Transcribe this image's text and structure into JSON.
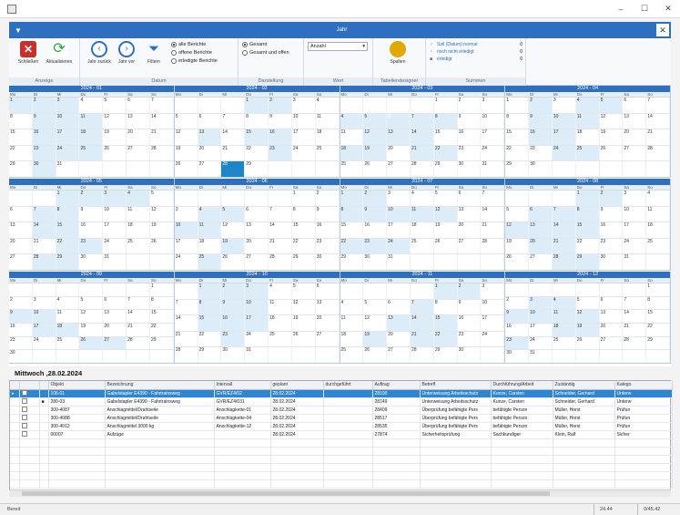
{
  "window": {
    "title": "",
    "minimize": "–",
    "maximize": "☐",
    "close": "✕"
  },
  "band": {
    "title": "Jahr",
    "arrow": "▼",
    "close": "✕"
  },
  "ribbon": {
    "groups": {
      "anzeige": "Anzeige",
      "datum": "Datum",
      "darstellung": "Darstellung",
      "wert": "Wert",
      "tabelle": "Tabellendesigner",
      "summen": "Summen"
    },
    "buttons": {
      "schliessen": "Schließen",
      "aktualisieren": "Aktualisieren",
      "jahr_zurueck": "Jahr zurück",
      "jahr_vor": "Jahr vor",
      "filtern": "Filtern",
      "spalten": "Spalten"
    },
    "radios": {
      "alle": "alle Berichte",
      "offene": "offene Berichte",
      "erledigte": "erledigte Berichte",
      "gesamt": "Gesamt",
      "gesamt_offen": "Gesamt und offen"
    },
    "dropdown": "Anzahl",
    "sums": [
      {
        "label": "Soll (Datum) normal",
        "value": "0"
      },
      {
        "label": "noch nicht erledigt",
        "value": "0"
      },
      {
        "label": "erledigt",
        "value": "0"
      }
    ],
    "colors": {
      "accent": "#2e6fc0",
      "close_red": "#c9302c",
      "refresh_green": "#2ea043",
      "columns_gold": "#e0a800"
    }
  },
  "weekdays": [
    "Mo",
    "Di",
    "Mi",
    "Do",
    "Fr",
    "Sa",
    "So"
  ],
  "months": [
    {
      "title": "2024 - 01",
      "rows": [
        [
          "1",
          "2",
          "3",
          "4",
          "5",
          "6",
          "7"
        ],
        [
          "8",
          "9",
          "10",
          "11",
          "12",
          "13",
          "14"
        ],
        [
          "15",
          "16",
          "17",
          "18",
          "19",
          "20",
          "21"
        ],
        [
          "22",
          "23",
          "24",
          "25",
          "26",
          "27",
          "28"
        ],
        [
          "29",
          "30",
          "31",
          "",
          "",
          "",
          ""
        ]
      ]
    },
    {
      "title": "2024 - 02",
      "rows": [
        [
          "",
          "",
          "",
          "1",
          "2",
          "3",
          "4"
        ],
        [
          "5",
          "6",
          "7",
          "8",
          "9",
          "10",
          "11"
        ],
        [
          "12",
          "13",
          "14",
          "15",
          "16",
          "17",
          "18"
        ],
        [
          "19",
          "20",
          "21",
          "22",
          "23",
          "24",
          "25"
        ],
        [
          "26",
          "27",
          "28",
          "29",
          "",
          "",
          ""
        ]
      ]
    },
    {
      "title": "2024 - 03",
      "rows": [
        [
          "",
          "",
          "",
          "",
          "1",
          "2",
          "3"
        ],
        [
          "4",
          "5",
          "6",
          "7",
          "8",
          "9",
          "10"
        ],
        [
          "11",
          "12",
          "13",
          "14",
          "15",
          "16",
          "17"
        ],
        [
          "18",
          "19",
          "20",
          "21",
          "22",
          "23",
          "24"
        ],
        [
          "25",
          "26",
          "27",
          "28",
          "29",
          "30",
          "31"
        ]
      ]
    },
    {
      "title": "2024 - 04",
      "rows": [
        [
          "1",
          "2",
          "3",
          "4",
          "5",
          "6",
          "7"
        ],
        [
          "8",
          "9",
          "10",
          "11",
          "12",
          "13",
          "14"
        ],
        [
          "15",
          "16",
          "17",
          "18",
          "19",
          "20",
          "21"
        ],
        [
          "22",
          "23",
          "24",
          "25",
          "26",
          "27",
          "28"
        ],
        [
          "29",
          "30",
          "",
          "",
          "",
          "",
          ""
        ]
      ]
    },
    {
      "title": "2024 - 05",
      "rows": [
        [
          "",
          "",
          "1",
          "2",
          "3",
          "4",
          "5"
        ],
        [
          "6",
          "7",
          "8",
          "9",
          "10",
          "11",
          "12"
        ],
        [
          "13",
          "14",
          "15",
          "16",
          "17",
          "18",
          "19"
        ],
        [
          "20",
          "21",
          "22",
          "23",
          "24",
          "25",
          "26"
        ],
        [
          "27",
          "28",
          "29",
          "30",
          "31",
          "",
          ""
        ]
      ]
    },
    {
      "title": "2024 - 06",
      "rows": [
        [
          "",
          "",
          "",
          "",
          "",
          "1",
          "2"
        ],
        [
          "3",
          "4",
          "5",
          "6",
          "7",
          "8",
          "9"
        ],
        [
          "10",
          "11",
          "12",
          "13",
          "14",
          "15",
          "16"
        ],
        [
          "17",
          "18",
          "19",
          "20",
          "21",
          "22",
          "23"
        ],
        [
          "24",
          "25",
          "26",
          "27",
          "28",
          "29",
          "30"
        ]
      ]
    },
    {
      "title": "2024 - 07",
      "rows": [
        [
          "1",
          "2",
          "3",
          "4",
          "5",
          "6",
          "7"
        ],
        [
          "8",
          "9",
          "10",
          "11",
          "12",
          "13",
          "14"
        ],
        [
          "15",
          "16",
          "17",
          "18",
          "19",
          "20",
          "21"
        ],
        [
          "22",
          "23",
          "24",
          "25",
          "26",
          "27",
          "28"
        ],
        [
          "29",
          "30",
          "31",
          "",
          "",
          "",
          ""
        ]
      ]
    },
    {
      "title": "2024 - 08",
      "rows": [
        [
          "",
          "",
          "",
          "1",
          "2",
          "3",
          "4"
        ],
        [
          "5",
          "6",
          "7",
          "8",
          "9",
          "10",
          "11"
        ],
        [
          "12",
          "13",
          "14",
          "15",
          "16",
          "17",
          "18"
        ],
        [
          "19",
          "20",
          "21",
          "22",
          "23",
          "24",
          "25"
        ],
        [
          "26",
          "27",
          "28",
          "29",
          "30",
          "31",
          ""
        ]
      ]
    },
    {
      "title": "2024 - 09",
      "rows": [
        [
          "",
          "",
          "",
          "",
          "",
          "",
          "1"
        ],
        [
          "2",
          "3",
          "4",
          "5",
          "6",
          "7",
          "8"
        ],
        [
          "9",
          "10",
          "11",
          "12",
          "13",
          "14",
          "15"
        ],
        [
          "16",
          "17",
          "18",
          "19",
          "20",
          "21",
          "22"
        ],
        [
          "23",
          "24",
          "25",
          "26",
          "27",
          "28",
          "29"
        ],
        [
          "30",
          "",
          "",
          "",
          "",
          "",
          ""
        ]
      ]
    },
    {
      "title": "2024 - 10",
      "rows": [
        [
          "",
          "1",
          "2",
          "3",
          "4",
          "5",
          "6"
        ],
        [
          "7",
          "8",
          "9",
          "10",
          "11",
          "12",
          "13"
        ],
        [
          "14",
          "15",
          "16",
          "17",
          "18",
          "19",
          "20"
        ],
        [
          "21",
          "22",
          "23",
          "24",
          "25",
          "26",
          "27"
        ],
        [
          "28",
          "29",
          "30",
          "31",
          "",
          "",
          ""
        ]
      ]
    },
    {
      "title": "2024 - 11",
      "rows": [
        [
          "",
          "",
          "",
          "",
          "1",
          "2",
          "3"
        ],
        [
          "4",
          "5",
          "6",
          "7",
          "8",
          "9",
          "10"
        ],
        [
          "11",
          "12",
          "13",
          "14",
          "15",
          "16",
          "17"
        ],
        [
          "18",
          "19",
          "20",
          "21",
          "22",
          "23",
          "24"
        ],
        [
          "25",
          "26",
          "27",
          "28",
          "29",
          "30",
          ""
        ]
      ]
    },
    {
      "title": "2024 - 12",
      "rows": [
        [
          "",
          "",
          "",
          "",
          "",
          "",
          "1"
        ],
        [
          "2",
          "3",
          "4",
          "5",
          "6",
          "7",
          "8"
        ],
        [
          "9",
          "10",
          "11",
          "12",
          "13",
          "14",
          "15"
        ],
        [
          "16",
          "17",
          "18",
          "19",
          "20",
          "21",
          "22"
        ],
        [
          "23",
          "24",
          "25",
          "26",
          "27",
          "28",
          "29"
        ],
        [
          "30",
          "31",
          "",
          "",
          "",
          "",
          ""
        ]
      ]
    }
  ],
  "day_label": "Mittwoch ,28.02.2024",
  "table": {
    "columns": [
      "",
      "",
      "",
      "Objekt",
      "Bezeichnung",
      "Intervall",
      "geplant",
      "durchgeführt",
      "Auftrag",
      "Betreff",
      "Durchführung/Arbeit",
      "Zuständig",
      "Katego"
    ],
    "rows": [
      {
        "c": [
          "▸",
          "",
          "",
          "106-01",
          "Gabelstapler E4390 - Fahrtrainsweg",
          "GVR/EZ4/02",
          "28.02.2024",
          "",
          "28100",
          "Unterweisung Arbeitsschutz",
          "Kunze, Carsten",
          "Schneider, Gerhard",
          "Unterw"
        ],
        "selected": true
      },
      {
        "c": [
          "",
          "",
          "■",
          "280-03",
          "Gabelstapler E4390 - Fahrtrainsweg",
          "GVR/EZ4/031",
          "28.02.2024",
          "",
          "28149",
          "Unterweisung Arbeitsschutz",
          "Kunze, Carsten",
          "Schneider, Gerhard",
          "Unterw"
        ],
        "selected": false
      },
      {
        "c": [
          "",
          "",
          "",
          "300-4087",
          "Anschlagmittel/Drahtseile",
          "Anschlagkette-01",
          "28.02.2024",
          "",
          "28409",
          "Überprüfung befähigte Pers",
          "befähigte Person",
          "Müller, Horst",
          "Prüfun"
        ],
        "selected": false
      },
      {
        "c": [
          "",
          "",
          "",
          "300-4088",
          "Anschlagmittel/Drahtseile",
          "Anschlagkette-04",
          "28.02.2024",
          "",
          "28517",
          "Überprüfung befähigte Pers",
          "befähigte Person",
          "Müller, Horst",
          "Prüfun"
        ],
        "selected": false
      },
      {
        "c": [
          "",
          "",
          "",
          "300-4012",
          "Anschlagmittel 3000 kg",
          "Anschlagkette-12",
          "28.02.2024",
          "",
          "28535",
          "Überprüfung befähigte Pers",
          "befähigte Person",
          "Müller, Horst",
          "Prüfun"
        ],
        "selected": false
      },
      {
        "c": [
          "",
          "",
          "",
          "00007",
          "Aufzüge",
          "",
          "28.02.2024",
          "",
          "27874",
          "Sicherheitsprüfung",
          "Sachkundiger",
          "Klein, Ralf",
          "Sicher"
        ],
        "selected": false
      }
    ]
  },
  "status": {
    "left": "Bereit",
    "middle": "24.44",
    "right": "0/45.42"
  }
}
